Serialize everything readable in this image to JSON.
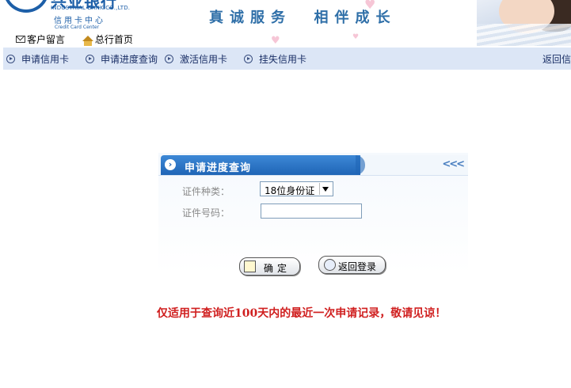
{
  "header": {
    "logo_cn": "兴业银行",
    "logo_en": "INDUSTRIAL BANK CO.,LTD.",
    "card_center_cn": "信用卡中心",
    "card_center_en": "Credit Card Center",
    "slogan": "真诚服务  相伴成长",
    "links": [
      {
        "label": "客户留言",
        "icon": "mail-icon"
      },
      {
        "label": "总行首页",
        "icon": "house-icon"
      }
    ]
  },
  "nav": {
    "items": [
      {
        "label": "申请信用卡",
        "icon": "circle-arrow-icon"
      },
      {
        "label": "申请进度查询",
        "icon": "circle-arrow-icon"
      },
      {
        "label": "激活信用卡",
        "icon": "circle-arrow-icon"
      },
      {
        "label": "挂失信用卡",
        "icon": "circle-arrow-icon"
      }
    ],
    "back_label": "返回信"
  },
  "panel": {
    "title": "申请进度查询",
    "collapse_label": "<<<",
    "id_type_label": "证件种类：",
    "id_type_value": "18位身份证",
    "id_number_label": "证件号码：",
    "id_number_value": "",
    "ok_label": "确定",
    "back_label": "返回登录"
  },
  "notice": "仅适用于查询近100天内的最近一次申请记录，敬请见谅！",
  "colors": {
    "brand_blue": "#1d5fa8",
    "nav_bg": "#dce6f6",
    "notice_red": "#d02020"
  }
}
